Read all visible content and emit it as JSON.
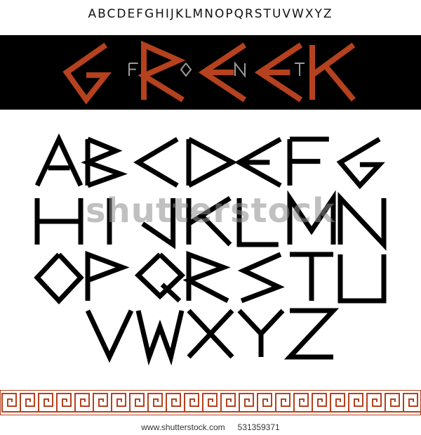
{
  "header": {
    "alphabet_line": "ABCDEFGHIJKLMNOPQRSTUVWXYZ"
  },
  "banner": {
    "title_letters": [
      "G",
      "R",
      "E",
      "E",
      "K"
    ],
    "subtitle_letters": [
      "F",
      "O",
      "N",
      "T"
    ],
    "title_color": "#b5411e",
    "subtitle_color": "#9a9a9a",
    "background": "#000000"
  },
  "alphabet_rows": [
    [
      "A",
      "B",
      "C",
      "D",
      "E",
      "F",
      "G"
    ],
    [
      "H",
      "I",
      "J",
      "K",
      "L",
      "M",
      "N"
    ],
    [
      "O",
      "P",
      "Q",
      "R",
      "S",
      "T",
      "U"
    ],
    [
      "V",
      "W",
      "X",
      "Y",
      "Z"
    ]
  ],
  "watermark": {
    "text": "shutterstock"
  },
  "border": {
    "pattern": "greek-key",
    "color": "#b5411e"
  },
  "footer": {
    "site": "www.shutterstock.com",
    "id": "531359371"
  }
}
